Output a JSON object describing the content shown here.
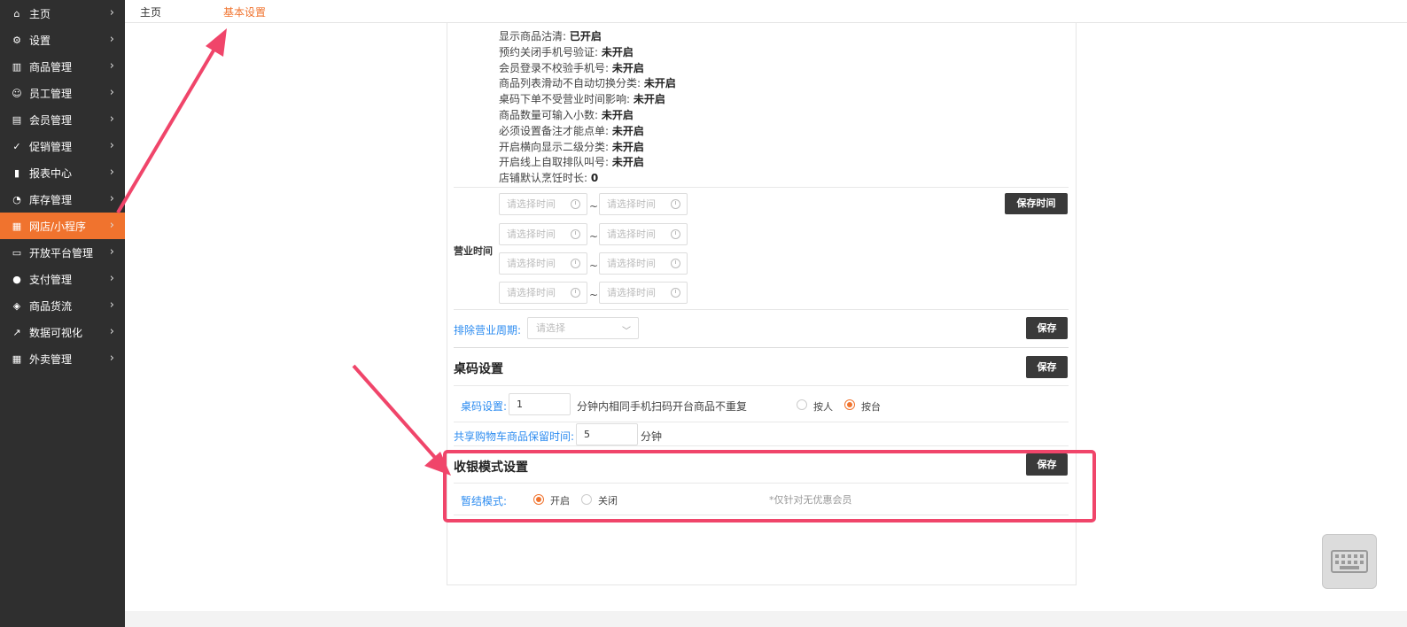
{
  "sidebar": {
    "items": [
      {
        "label": "主页",
        "icon": "home-icon",
        "glyph": "⌂",
        "active": false
      },
      {
        "label": "设置",
        "icon": "gear-icon",
        "glyph": "⚙",
        "active": false
      },
      {
        "label": "商品管理",
        "icon": "barcode-icon",
        "glyph": "▥",
        "active": false
      },
      {
        "label": "员工管理",
        "icon": "user-icon",
        "glyph": "☺",
        "active": false
      },
      {
        "label": "会员管理",
        "icon": "member-card-icon",
        "glyph": "▤",
        "active": false
      },
      {
        "label": "促销管理",
        "icon": "check-circle-icon",
        "glyph": "✓",
        "active": false
      },
      {
        "label": "报表中心",
        "icon": "bar-chart-icon",
        "glyph": "▮",
        "active": false
      },
      {
        "label": "库存管理",
        "icon": "pie-chart-icon",
        "glyph": "◔",
        "active": false
      },
      {
        "label": "网店/小程序",
        "icon": "shop-icon",
        "glyph": "▦",
        "active": true
      },
      {
        "label": "开放平台管理",
        "icon": "monitor-icon",
        "glyph": "▭",
        "active": false
      },
      {
        "label": "支付管理",
        "icon": "coin-icon",
        "glyph": "●",
        "active": false
      },
      {
        "label": "商品货流",
        "icon": "cube-icon",
        "glyph": "◈",
        "active": false
      },
      {
        "label": "数据可视化",
        "icon": "line-chart-icon",
        "glyph": "↗",
        "active": false
      },
      {
        "label": "外卖管理",
        "icon": "store-icon",
        "glyph": "▦",
        "active": false
      }
    ]
  },
  "topbar": {
    "home": "主页",
    "current": "基本设置"
  },
  "settings_list": [
    {
      "key": "显示商品沽清: ",
      "value": "已开启"
    },
    {
      "key": "预约关闭手机号验证: ",
      "value": "未开启"
    },
    {
      "key": "会员登录不校验手机号: ",
      "value": "未开启"
    },
    {
      "key": "商品列表滑动不自动切换分类: ",
      "value": "未开启"
    },
    {
      "key": "桌码下单不受营业时间影响: ",
      "value": "未开启"
    },
    {
      "key": "商品数量可输入小数: ",
      "value": "未开启"
    },
    {
      "key": "必须设置备注才能点单: ",
      "value": "未开启"
    },
    {
      "key": "开启横向显示二级分类: ",
      "value": "未开启"
    },
    {
      "key": "开启线上自取排队叫号: ",
      "value": "未开启"
    },
    {
      "key": "店铺默认烹饪时长: ",
      "value": "0"
    }
  ],
  "business_hours": {
    "label": "营业时间",
    "placeholder": "请选择时间",
    "tilde": "~",
    "save_label": "保存时间"
  },
  "exclude_period": {
    "label": "排除营业周期:",
    "placeholder": "请选择",
    "save_label": "保存"
  },
  "table_code": {
    "title": "桌码设置",
    "save_label": "保存",
    "code_label": "桌码设置:",
    "code_value": "1",
    "code_suffix": "分钟内相同手机扫码开台商品不重复",
    "radio_by_person": "按人",
    "radio_by_table": "按台",
    "selected": "按台",
    "cart_label": "共享购物车商品保留时间:",
    "cart_value": "5",
    "cart_suffix": "分钟"
  },
  "cashier_mode": {
    "title": "收银模式设置",
    "save_label": "保存",
    "mode_label": "暂结模式:",
    "radio_on": "开启",
    "radio_off": "关闭",
    "selected": "开启",
    "note": "*仅针对无优惠会员"
  },
  "colors": {
    "accent": "#f0732e",
    "link": "#2d8cf0",
    "annotation": "#f0456a",
    "sidebar_bg": "#2f2f2f"
  }
}
